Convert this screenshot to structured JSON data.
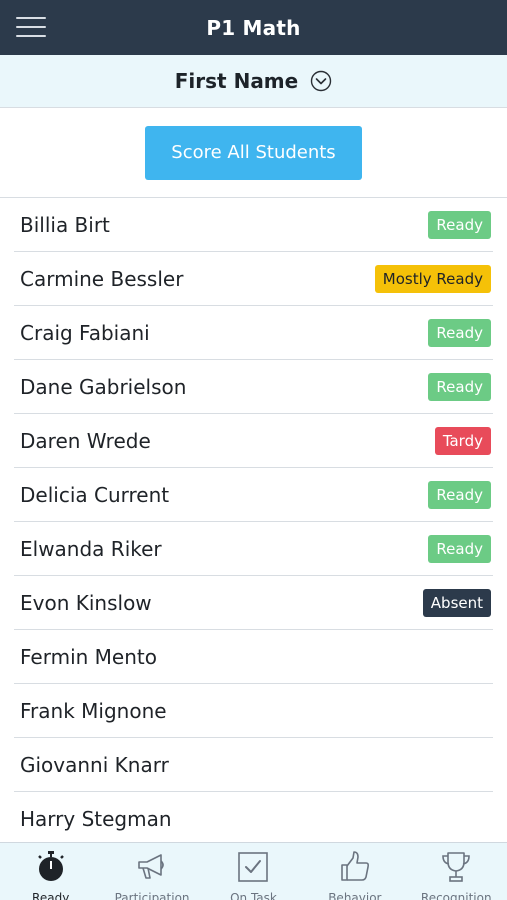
{
  "header": {
    "title": "P1 Math"
  },
  "sort": {
    "label": "First Name"
  },
  "actions": {
    "score_all": "Score All Students"
  },
  "students": [
    {
      "name": "Billia Birt",
      "status": "Ready",
      "status_type": "ready"
    },
    {
      "name": "Carmine Bessler",
      "status": "Mostly Ready",
      "status_type": "mostly"
    },
    {
      "name": "Craig Fabiani",
      "status": "Ready",
      "status_type": "ready"
    },
    {
      "name": "Dane Gabrielson",
      "status": "Ready",
      "status_type": "ready"
    },
    {
      "name": "Daren Wrede",
      "status": "Tardy",
      "status_type": "tardy"
    },
    {
      "name": "Delicia Current",
      "status": "Ready",
      "status_type": "ready"
    },
    {
      "name": "Elwanda Riker",
      "status": "Ready",
      "status_type": "ready"
    },
    {
      "name": "Evon Kinslow",
      "status": "Absent",
      "status_type": "absent"
    },
    {
      "name": "Fermin Mento",
      "status": "",
      "status_type": ""
    },
    {
      "name": "Frank Mignone",
      "status": "",
      "status_type": ""
    },
    {
      "name": "Giovanni Knarr",
      "status": "",
      "status_type": ""
    },
    {
      "name": "Harry Stegman",
      "status": "",
      "status_type": ""
    }
  ],
  "tabs": [
    {
      "label": "Ready",
      "icon": "stopwatch-icon",
      "active": true
    },
    {
      "label": "Participation",
      "icon": "megaphone-icon",
      "active": false
    },
    {
      "label": "On Task",
      "icon": "checkbox-icon",
      "active": false
    },
    {
      "label": "Behavior",
      "icon": "thumbs-up-icon",
      "active": false
    },
    {
      "label": "Recognition",
      "icon": "trophy-icon",
      "active": false
    }
  ],
  "colors": {
    "header_bg": "#2c3a4b",
    "accent": "#3fb5ef",
    "ready": "#6ccb85",
    "mostly_ready": "#f5c108",
    "tardy": "#e84b5a",
    "absent": "#2c3a4b"
  }
}
